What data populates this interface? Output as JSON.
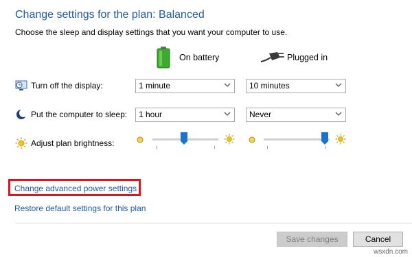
{
  "header": {
    "title": "Change settings for the plan: Balanced",
    "subtitle": "Choose the sleep and display settings that you want your computer to use."
  },
  "columns": {
    "battery_label": "On battery",
    "plugged_label": "Plugged in"
  },
  "rows": [
    {
      "label": "Turn off the display:",
      "icon": "display-clock-icon",
      "battery_value": "1 minute",
      "plugged_value": "10 minutes"
    },
    {
      "label": "Put the computer to sleep:",
      "icon": "moon-icon",
      "battery_value": "1 hour",
      "plugged_value": "Never"
    }
  ],
  "brightness": {
    "label": "Adjust plan brightness:",
    "battery_level": 0.48,
    "plugged_level": 0.98
  },
  "links": {
    "advanced": "Change advanced power settings",
    "restore": "Restore default settings for this plan"
  },
  "buttons": {
    "save": "Save changes",
    "cancel": "Cancel"
  },
  "watermark": "wsxdn.com",
  "colors": {
    "title_blue": "#1e5aa8",
    "highlight_red": "#e0141e",
    "slider_blue": "#1a73d1"
  }
}
